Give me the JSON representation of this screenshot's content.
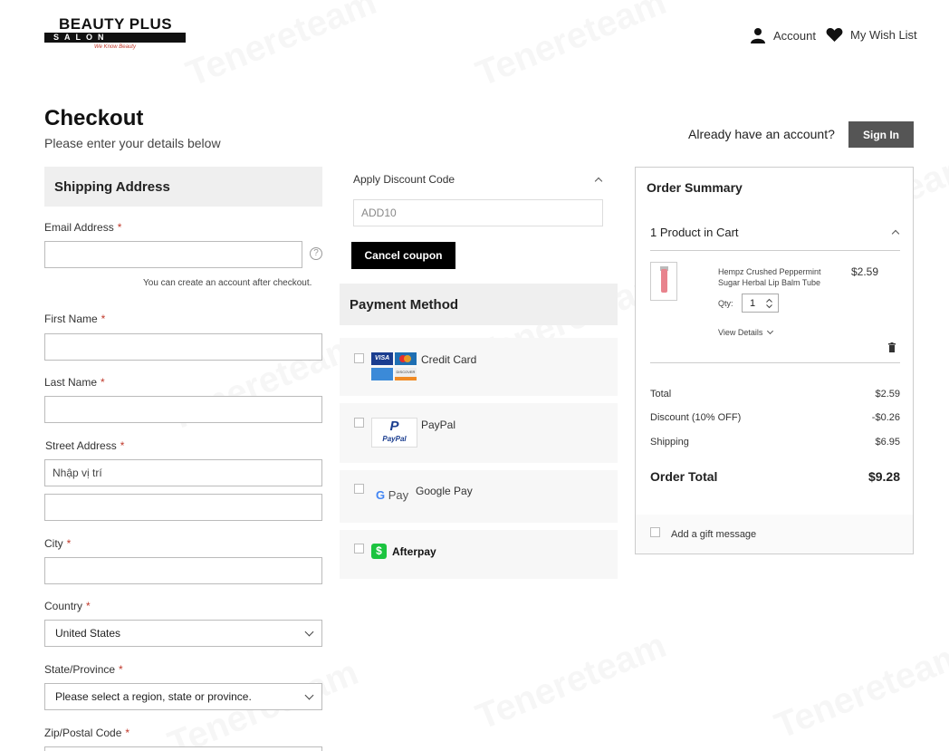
{
  "brand": {
    "line1": "BEAUTY PLUS",
    "line2": "SALON",
    "tagline": "We Know Beauty"
  },
  "header": {
    "account_label": "Account",
    "wishlist_label": "My Wish List"
  },
  "page": {
    "title": "Checkout",
    "subtitle": "Please enter your details below",
    "have_account": "Already have an account?",
    "signin_label": "Sign In"
  },
  "shipping": {
    "heading": "Shipping Address",
    "email_label": "Email Address",
    "email_hint": "You can create an account after checkout.",
    "first_name_label": "First Name",
    "last_name_label": "Last Name",
    "street_label": "Street Address",
    "street_value": "Nhập vị trí",
    "city_label": "City",
    "country_label": "Country",
    "country_value": "United States",
    "state_label": "State/Province",
    "state_value": "Please select a region, state or province.",
    "zip_label": "Zip/Postal Code",
    "required_mark": "*"
  },
  "discount": {
    "heading": "Apply Discount Code",
    "code": "ADD10",
    "cancel_label": "Cancel coupon"
  },
  "payment": {
    "heading": "Payment Method",
    "credit_card": "Credit Card",
    "paypal": "PayPal",
    "google_pay": "Google Pay",
    "afterpay": "Afterpay",
    "visa": "VISA",
    "discover": "DISCOVER",
    "paypal_logo": "PayPal",
    "gpay_logo": "Pay"
  },
  "summary": {
    "heading": "Order Summary",
    "cart_count": "1 Product in Cart",
    "product_name": "Hempz Crushed Peppermint Sugar Herbal Lip Balm Tube",
    "product_price": "$2.59",
    "qty_label": "Qty:",
    "qty_value": "1",
    "view_details": "View Details",
    "total_label": "Total",
    "total_value": "$2.59",
    "discount_label": "Discount (10% OFF)",
    "discount_value": "-$0.26",
    "shipping_label": "Shipping",
    "shipping_value": "$6.95",
    "order_total_label": "Order Total",
    "order_total_value": "$9.28",
    "gift_label": "Add a gift message"
  },
  "watermark": "Tenereteam"
}
